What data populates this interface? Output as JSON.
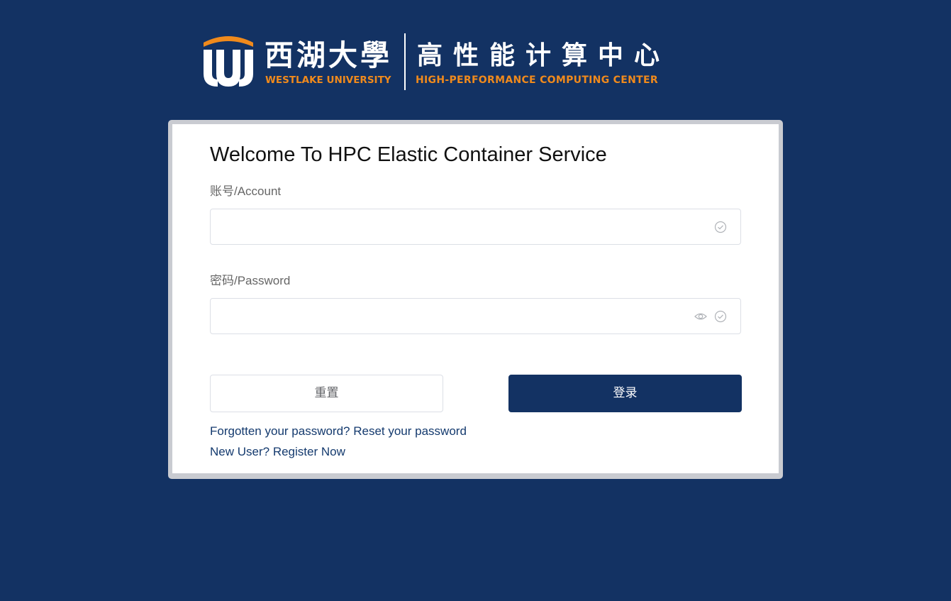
{
  "header": {
    "university_cn": "西湖大學",
    "university_en": "WESTLAKE UNIVERSITY",
    "center_cn": "高性能计算中心",
    "center_en": "HIGH-PERFORMANCE COMPUTING CENTER"
  },
  "login": {
    "title": "Welcome To HPC Elastic Container Service",
    "account_label": "账号/Account",
    "account_value": "",
    "password_label": "密码/Password",
    "password_value": "",
    "reset_button": "重置",
    "login_button": "登录",
    "forgot_prefix": "Forgotten your password? ",
    "forgot_link": "Reset your password",
    "new_user_prefix": "New User? ",
    "register_link": "Register Now"
  },
  "colors": {
    "background": "#133263",
    "brand_orange": "#f08a1c",
    "primary_button": "#133263",
    "link": "#143a6e"
  },
  "icons": {
    "account_suffix": "circle-check-icon",
    "password_suffix_1": "eye-icon",
    "password_suffix_2": "circle-check-icon"
  }
}
